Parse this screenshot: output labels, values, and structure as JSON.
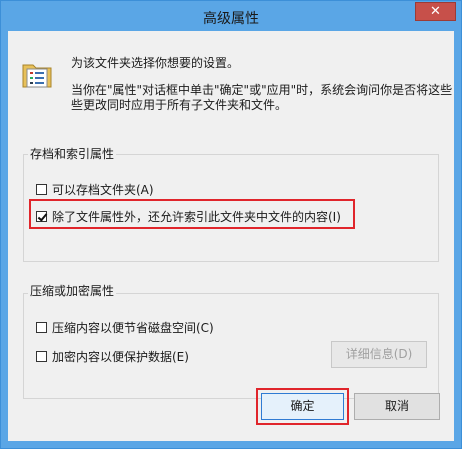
{
  "window": {
    "title": "高级属性",
    "close_glyph": "✕"
  },
  "description": {
    "line1": "为该文件夹选择你想要的设置。",
    "line2": "当你在\"属性\"对话框中单击\"确定\"或\"应用\"时，系统会询问你是否将这些",
    "line3": "些更改同时应用于所有子文件夹和文件。"
  },
  "archive_group": {
    "label": "存档和索引属性",
    "items": [
      {
        "label": "可以存档文件夹(A)",
        "checked": false
      },
      {
        "label": "除了文件属性外，还允许索引此文件夹中文件的内容(I)",
        "checked": true
      }
    ]
  },
  "compress_group": {
    "label": "压缩或加密属性",
    "items": [
      {
        "label": "压缩内容以便节省磁盘空间(C)",
        "checked": false
      },
      {
        "label": "加密内容以便保护数据(E)",
        "checked": false
      }
    ],
    "details_button": "详细信息(D)"
  },
  "buttons": {
    "ok": "确定",
    "cancel": "取消"
  },
  "colors": {
    "title_bar": "#5aa6e6",
    "close_button": "#c7504a",
    "highlight": "#e0252b",
    "dialog_bg": "#f0f0f0"
  }
}
